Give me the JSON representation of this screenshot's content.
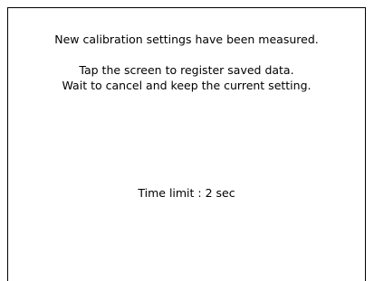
{
  "dialog": {
    "message_measured": "New calibration settings have been measured.",
    "instruction_tap": "Tap the screen to register saved data.",
    "instruction_wait": "Wait to cancel and keep the current setting.",
    "time_limit": "Time limit : 2 sec"
  }
}
